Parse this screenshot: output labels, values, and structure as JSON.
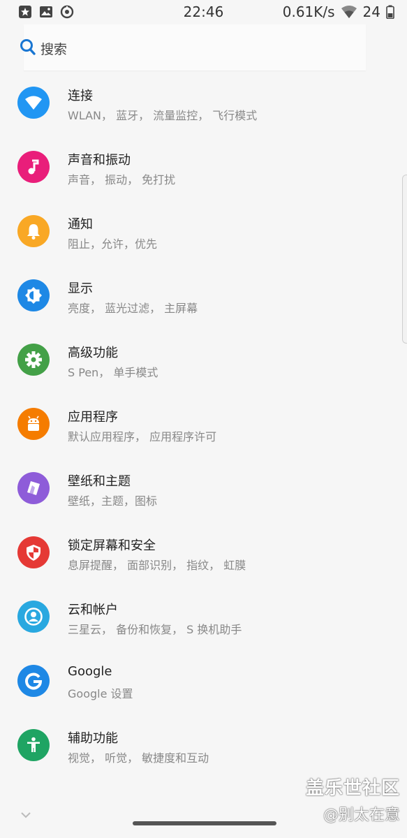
{
  "status_bar": {
    "time": "22:46",
    "net_speed": "0.61K/s",
    "battery": "24",
    "icons": [
      "gallery-notification-icon",
      "image-notification-icon",
      "sync-notification-icon",
      "wifi-icon",
      "battery-icon"
    ]
  },
  "search": {
    "placeholder": "搜索"
  },
  "items": [
    {
      "title": "连接",
      "subtitle": "WLAN， 蓝牙， 流量监控， 飞行模式",
      "icon": "wifi-icon",
      "color": "#2196f3"
    },
    {
      "title": "声音和振动",
      "subtitle": "声音， 振动， 免打扰",
      "icon": "music-note-icon",
      "color": "#e91e7a"
    },
    {
      "title": "通知",
      "subtitle": "阻止，允许，优先",
      "icon": "bell-icon",
      "color": "#f9a825"
    },
    {
      "title": "显示",
      "subtitle": "亮度， 蓝光过滤， 主屏幕",
      "icon": "brightness-icon",
      "color": "#1e88e5"
    },
    {
      "title": "高级功能",
      "subtitle": "S Pen， 单手模式",
      "icon": "gear-icon",
      "color": "#43a047"
    },
    {
      "title": "应用程序",
      "subtitle": "默认应用程序， 应用程序许可",
      "icon": "android-icon",
      "color": "#f57c00"
    },
    {
      "title": "壁纸和主题",
      "subtitle": "壁纸，主题，图标",
      "icon": "theme-brush-icon",
      "color": "#8e5cd9"
    },
    {
      "title": "锁定屏幕和安全",
      "subtitle": "息屏提醒， 面部识别， 指纹， 虹膜",
      "icon": "shield-icon",
      "color": "#e53935"
    },
    {
      "title": "云和帐户",
      "subtitle": "三星云， 备份和恢复， S 换机助手",
      "icon": "account-icon",
      "color": "#29a8e0"
    },
    {
      "title": "Google",
      "subtitle": "Google 设置",
      "icon": "google-g-icon",
      "color": "#1e88e5"
    },
    {
      "title": "辅助功能",
      "subtitle": "视觉， 听觉， 敏捷度和互动",
      "icon": "accessibility-icon",
      "color": "#1fa463"
    }
  ],
  "watermark": {
    "line1": "盖乐世社区",
    "line2": "@别太在意"
  }
}
